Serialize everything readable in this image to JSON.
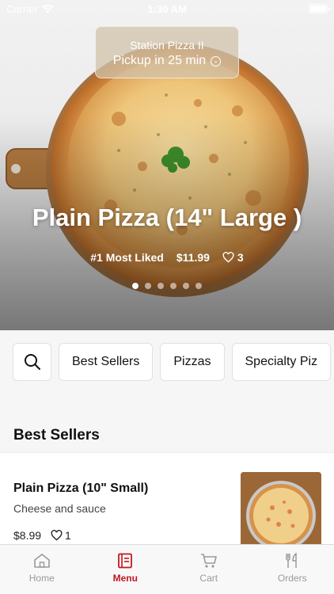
{
  "status_bar": {
    "carrier": "Carrier",
    "time": "1:30 AM"
  },
  "store": {
    "name": "Station Pizza II",
    "pickup": "Pickup in 25 min"
  },
  "hero": {
    "title": "Plain Pizza (14\" Large )",
    "rank": "#1 Most Liked",
    "price": "$11.99",
    "likes": "3",
    "slide_count": 6,
    "active_slide": 1
  },
  "categories": {
    "search_icon": "search-icon",
    "items": [
      "Best Sellers",
      "Pizzas",
      "Specialty Piz"
    ]
  },
  "section": {
    "title": "Best Sellers"
  },
  "menu_item": {
    "name": "Plain Pizza (10\" Small)",
    "description": "Cheese and sauce",
    "price": "$8.99",
    "likes": "1"
  },
  "tabbar": {
    "tabs": [
      {
        "label": "Home",
        "icon": "home-icon"
      },
      {
        "label": "Menu",
        "icon": "menu-icon"
      },
      {
        "label": "Cart",
        "icon": "cart-icon"
      },
      {
        "label": "Orders",
        "icon": "utensils-icon"
      }
    ],
    "active": "Menu"
  },
  "colors": {
    "accent": "#c0191f",
    "tab_inactive": "#9a9a9a",
    "chip_border": "#e1e1e1"
  }
}
